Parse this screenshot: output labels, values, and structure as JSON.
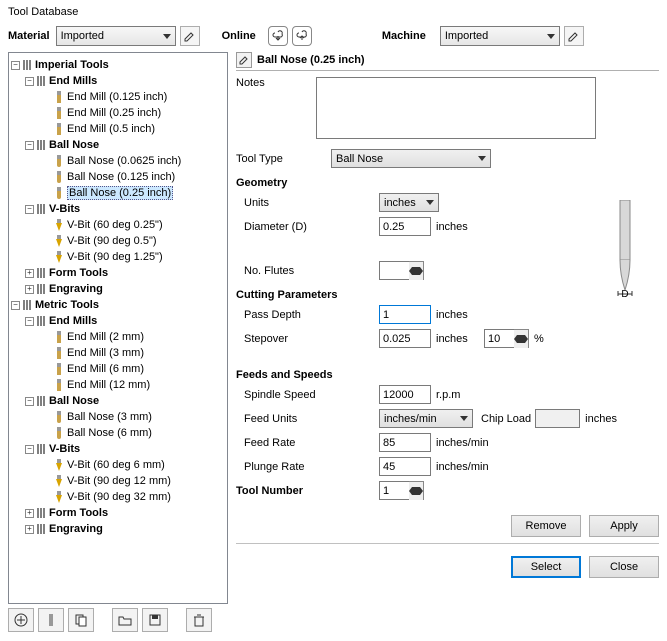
{
  "window": {
    "title": "Tool Database"
  },
  "material": {
    "label": "Material",
    "value": "Imported"
  },
  "online": {
    "label": "Online"
  },
  "machine": {
    "label": "Machine",
    "value": "Imported"
  },
  "tree": {
    "imperial": {
      "label": "Imperial Tools",
      "end_mills": {
        "label": "End Mills",
        "items": [
          "End Mill (0.125 inch)",
          "End Mill (0.25 inch)",
          "End Mill (0.5 inch)"
        ]
      },
      "ball_nose": {
        "label": "Ball Nose",
        "items": [
          "Ball Nose (0.0625 inch)",
          "Ball Nose (0.125 inch)",
          "Ball Nose (0.25 inch)"
        ]
      },
      "vbits": {
        "label": "V-Bits",
        "items": [
          "V-Bit (60 deg 0.25\")",
          "V-Bit (90 deg 0.5\")",
          "V-Bit (90 deg 1.25\")"
        ]
      },
      "form_tools": {
        "label": "Form Tools"
      },
      "engraving": {
        "label": "Engraving"
      }
    },
    "metric": {
      "label": "Metric Tools",
      "end_mills": {
        "label": "End Mills",
        "items": [
          "End Mill (2 mm)",
          "End Mill (3 mm)",
          "End Mill (6 mm)",
          "End Mill (12 mm)"
        ]
      },
      "ball_nose": {
        "label": "Ball Nose",
        "items": [
          "Ball Nose (3 mm)",
          "Ball Nose (6 mm)"
        ]
      },
      "vbits": {
        "label": "V-Bits",
        "items": [
          "V-Bit (60 deg 6 mm)",
          "V-Bit (90 deg 12 mm)",
          "V-Bit (90 deg 32 mm)"
        ]
      },
      "form_tools": {
        "label": "Form Tools"
      },
      "engraving": {
        "label": "Engraving"
      }
    }
  },
  "editor": {
    "title": "Ball Nose (0.25 inch)",
    "notes_label": "Notes",
    "notes_value": "",
    "tool_type_label": "Tool Type",
    "tool_type_value": "Ball Nose",
    "geometry": {
      "heading": "Geometry",
      "units_label": "Units",
      "units_value": "inches",
      "diameter_label": "Diameter (D)",
      "diameter_value": "0.25",
      "diameter_units": "inches",
      "diagram_d": "D"
    },
    "no_flutes_label": "No. Flutes",
    "no_flutes_value": "",
    "cutting": {
      "heading": "Cutting Parameters",
      "pass_depth_label": "Pass Depth",
      "pass_depth_value": "1",
      "pass_depth_units": "inches",
      "stepover_label": "Stepover",
      "stepover_value": "0.025",
      "stepover_units": "inches",
      "stepover_pct": "10",
      "pct_symbol": "%"
    },
    "feeds": {
      "heading": "Feeds and Speeds",
      "spindle_label": "Spindle Speed",
      "spindle_value": "12000",
      "spindle_units": "r.p.m",
      "feed_units_label": "Feed Units",
      "feed_units_value": "inches/min",
      "chip_load_label": "Chip Load",
      "chip_load_value": "",
      "chip_load_units": "inches",
      "feed_rate_label": "Feed Rate",
      "feed_rate_value": "85",
      "feed_rate_units": "inches/min",
      "plunge_rate_label": "Plunge Rate",
      "plunge_rate_value": "45",
      "plunge_rate_units": "inches/min"
    },
    "tool_number_label": "Tool Number",
    "tool_number_value": "1"
  },
  "buttons": {
    "remove": "Remove",
    "apply": "Apply",
    "select": "Select",
    "close": "Close"
  }
}
